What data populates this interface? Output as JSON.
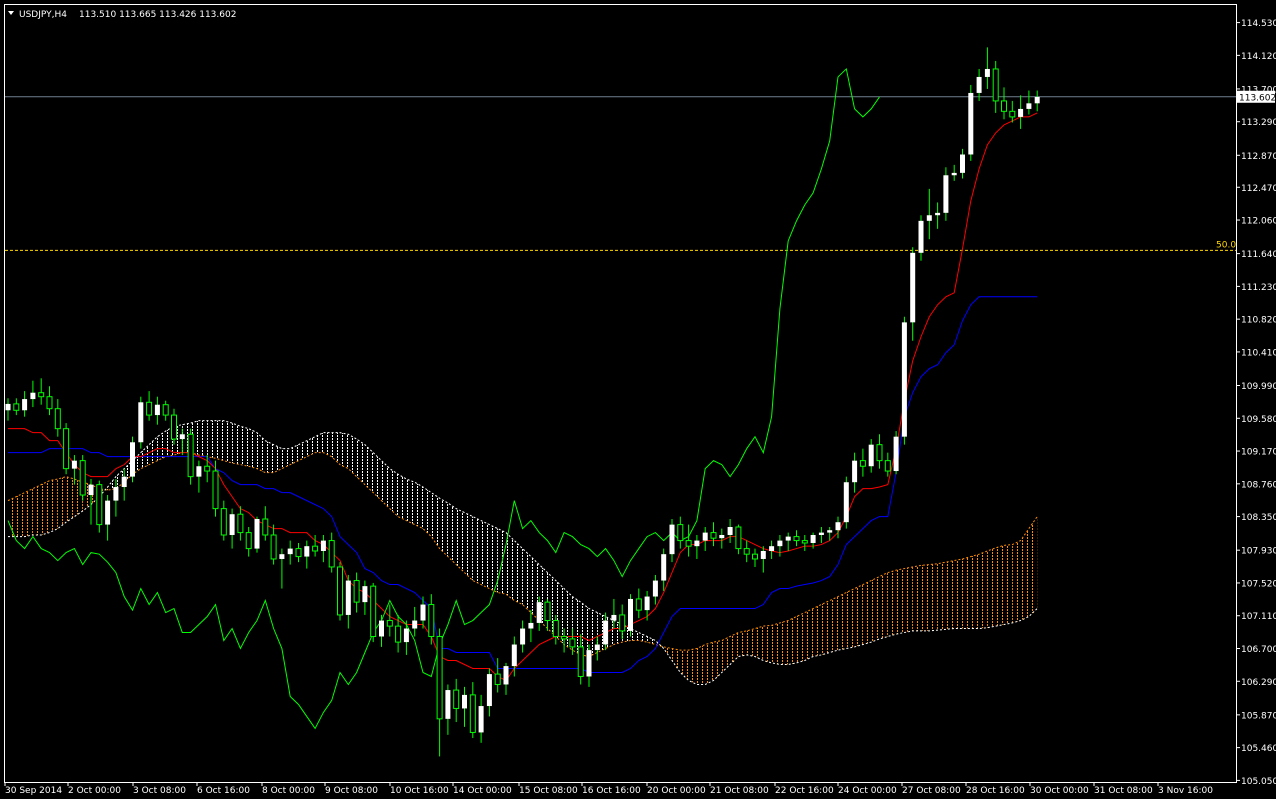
{
  "window": {
    "symbol_title": "USDJPY,H4",
    "ohlc": "113.510 113.665 113.426 113.602",
    "menu_icon": "triangle-down-icon"
  },
  "colors": {
    "background": "#000000",
    "frame": "#ffffff",
    "bull_candle": "#ffffff",
    "wick": "#00ff00",
    "tenkan": "#ff0000",
    "kijun": "#0000ff",
    "chikou": "#00ff00",
    "cloud_bear": "#ffffff",
    "cloud_bull": "#ff8c00",
    "bid_line": "#708090",
    "fibo_line": "#ffd700"
  },
  "chart_data": {
    "type": "candlestick",
    "timeframe": "H4",
    "ylim": [
      105.03,
      114.75
    ],
    "y_ticks": [
      "114.530",
      "114.120",
      "113.700",
      "113.290",
      "112.870",
      "112.470",
      "112.060",
      "111.640",
      "111.230",
      "110.820",
      "110.410",
      "109.990",
      "109.580",
      "109.170",
      "108.760",
      "108.350",
      "107.930",
      "107.520",
      "107.110",
      "106.700",
      "106.290",
      "105.870",
      "105.460",
      "105.050"
    ],
    "x_ticks": [
      "30 Sep 2014",
      "2 Oct 00:00",
      "3 Oct 08:00",
      "6 Oct 16:00",
      "8 Oct 00:00",
      "9 Oct 08:00",
      "10 Oct 16:00",
      "14 Oct 00:00",
      "15 Oct 08:00",
      "16 Oct 16:00",
      "20 Oct 00:00",
      "21 Oct 08:00",
      "22 Oct 16:00",
      "24 Oct 00:00",
      "27 Oct 08:00",
      "28 Oct 16:00",
      "30 Oct 00:00",
      "31 Oct 08:00",
      "3 Nov 16:00"
    ],
    "current_price": "113.602",
    "fibo_label": "50.0",
    "fibo_level": 111.68,
    "candles": [
      [
        109.68,
        109.83,
        109.55,
        109.76
      ],
      [
        109.76,
        109.83,
        109.62,
        109.68
      ],
      [
        109.68,
        109.92,
        109.6,
        109.82
      ],
      [
        109.82,
        110.05,
        109.72,
        109.9
      ],
      [
        109.9,
        110.08,
        109.75,
        109.85
      ],
      [
        109.85,
        109.98,
        109.62,
        109.7
      ],
      [
        109.7,
        109.82,
        109.35,
        109.45
      ],
      [
        109.45,
        109.52,
        108.88,
        108.95
      ],
      [
        108.95,
        109.12,
        108.75,
        109.05
      ],
      [
        109.05,
        109.12,
        108.55,
        108.62
      ],
      [
        108.62,
        108.82,
        108.25,
        108.75
      ],
      [
        108.75,
        108.8,
        108.15,
        108.25
      ],
      [
        108.25,
        108.62,
        108.05,
        108.55
      ],
      [
        108.55,
        108.82,
        108.35,
        108.72
      ],
      [
        108.72,
        108.95,
        108.55,
        108.85
      ],
      [
        108.85,
        109.35,
        108.78,
        109.28
      ],
      [
        109.28,
        109.85,
        109.2,
        109.78
      ],
      [
        109.78,
        109.92,
        109.55,
        109.62
      ],
      [
        109.62,
        109.85,
        109.5,
        109.75
      ],
      [
        109.75,
        109.8,
        109.55,
        109.62
      ],
      [
        109.62,
        109.7,
        109.25,
        109.32
      ],
      [
        109.32,
        109.45,
        109.12,
        109.38
      ],
      [
        109.38,
        109.45,
        108.75,
        108.85
      ],
      [
        108.85,
        109.05,
        108.65,
        108.98
      ],
      [
        108.98,
        109.12,
        108.78,
        108.92
      ],
      [
        108.92,
        109.05,
        108.35,
        108.45
      ],
      [
        108.45,
        108.55,
        108.05,
        108.12
      ],
      [
        108.12,
        108.45,
        107.95,
        108.38
      ],
      [
        108.38,
        108.48,
        108.05,
        108.15
      ],
      [
        108.15,
        108.22,
        107.85,
        107.95
      ],
      [
        107.95,
        108.35,
        107.9,
        108.32
      ],
      [
        108.32,
        108.48,
        108.05,
        108.12
      ],
      [
        108.12,
        108.25,
        107.75,
        107.82
      ],
      [
        107.82,
        107.95,
        107.45,
        107.88
      ],
      [
        107.88,
        108.05,
        107.75,
        107.95
      ],
      [
        107.95,
        108.02,
        107.78,
        107.85
      ],
      [
        107.85,
        108.05,
        107.7,
        107.98
      ],
      [
        107.98,
        108.12,
        107.85,
        107.92
      ],
      [
        107.92,
        108.12,
        107.78,
        108.05
      ],
      [
        108.05,
        108.15,
        107.65,
        107.72
      ],
      [
        107.72,
        107.78,
        107.05,
        107.12
      ],
      [
        107.12,
        107.62,
        106.95,
        107.55
      ],
      [
        107.55,
        107.65,
        107.15,
        107.28
      ],
      [
        107.28,
        107.55,
        107.12,
        107.48
      ],
      [
        107.48,
        107.52,
        106.78,
        106.85
      ],
      [
        106.85,
        107.12,
        106.72,
        107.05
      ],
      [
        107.05,
        107.25,
        106.85,
        106.98
      ],
      [
        106.98,
        107.12,
        106.65,
        106.78
      ],
      [
        106.78,
        107.05,
        106.62,
        106.95
      ],
      [
        106.95,
        107.22,
        106.85,
        107.05
      ],
      [
        107.05,
        107.35,
        106.95,
        107.25
      ],
      [
        107.25,
        107.38,
        106.75,
        106.85
      ],
      [
        106.85,
        106.95,
        105.35,
        105.82
      ],
      [
        105.82,
        106.25,
        105.62,
        106.18
      ],
      [
        106.18,
        106.32,
        105.78,
        105.95
      ],
      [
        105.95,
        106.22,
        105.72,
        106.12
      ],
      [
        106.12,
        106.28,
        105.58,
        105.65
      ],
      [
        105.65,
        106.12,
        105.52,
        105.98
      ],
      [
        105.98,
        106.45,
        105.85,
        106.38
      ],
      [
        106.38,
        106.58,
        106.15,
        106.25
      ],
      [
        106.25,
        106.52,
        106.12,
        106.48
      ],
      [
        106.48,
        106.85,
        106.35,
        106.75
      ],
      [
        106.75,
        107.05,
        106.65,
        106.95
      ],
      [
        106.95,
        107.18,
        106.78,
        107.02
      ],
      [
        107.02,
        107.35,
        106.92,
        107.28
      ],
      [
        107.28,
        107.32,
        106.92,
        107.05
      ],
      [
        107.05,
        107.12,
        106.75,
        106.85
      ],
      [
        106.85,
        106.95,
        106.65,
        106.82
      ],
      [
        106.82,
        106.95,
        106.62,
        106.72
      ],
      [
        106.72,
        106.88,
        106.25,
        106.35
      ],
      [
        106.35,
        106.75,
        106.22,
        106.68
      ],
      [
        106.68,
        106.85,
        106.55,
        106.75
      ],
      [
        106.75,
        107.15,
        106.68,
        107.05
      ],
      [
        107.05,
        107.32,
        106.95,
        107.12
      ],
      [
        107.12,
        107.25,
        106.82,
        106.92
      ],
      [
        106.92,
        107.38,
        106.85,
        107.32
      ],
      [
        107.32,
        107.45,
        107.08,
        107.18
      ],
      [
        107.18,
        107.42,
        107.05,
        107.35
      ],
      [
        107.35,
        107.62,
        107.25,
        107.55
      ],
      [
        107.55,
        107.95,
        107.42,
        107.88
      ],
      [
        107.88,
        108.32,
        107.78,
        108.25
      ],
      [
        108.25,
        108.35,
        107.95,
        108.05
      ],
      [
        108.05,
        108.25,
        107.85,
        107.98
      ],
      [
        107.98,
        108.12,
        107.82,
        108.05
      ],
      [
        108.05,
        108.22,
        107.92,
        108.15
      ],
      [
        108.15,
        108.28,
        107.98,
        108.08
      ],
      [
        108.08,
        108.2,
        107.95,
        108.12
      ],
      [
        108.12,
        108.32,
        108.02,
        108.22
      ],
      [
        108.22,
        108.25,
        107.88,
        107.95
      ],
      [
        107.95,
        108.05,
        107.78,
        107.88
      ],
      [
        107.88,
        107.95,
        107.72,
        107.82
      ],
      [
        107.82,
        107.98,
        107.65,
        107.92
      ],
      [
        107.92,
        108.05,
        107.82,
        107.98
      ],
      [
        107.98,
        108.12,
        107.85,
        108.05
      ],
      [
        108.05,
        108.15,
        107.92,
        108.1
      ],
      [
        108.1,
        108.18,
        107.98,
        108.05
      ],
      [
        108.05,
        108.12,
        107.92,
        108.02
      ],
      [
        108.02,
        108.15,
        107.95,
        108.12
      ],
      [
        108.12,
        108.22,
        108.02,
        108.15
      ],
      [
        108.15,
        108.22,
        108.05,
        108.18
      ],
      [
        108.18,
        108.35,
        108.08,
        108.28
      ],
      [
        108.28,
        108.85,
        108.2,
        108.78
      ],
      [
        108.78,
        109.15,
        108.65,
        109.05
      ],
      [
        109.05,
        109.2,
        108.85,
        108.98
      ],
      [
        108.98,
        109.32,
        108.9,
        109.25
      ],
      [
        109.25,
        109.38,
        108.95,
        109.05
      ],
      [
        109.05,
        109.15,
        108.85,
        108.92
      ],
      [
        108.92,
        109.42,
        108.88,
        109.35
      ],
      [
        109.35,
        110.85,
        109.25,
        110.78
      ],
      [
        110.78,
        111.72,
        110.55,
        111.65
      ],
      [
        111.65,
        112.12,
        111.55,
        112.05
      ],
      [
        112.05,
        112.45,
        111.82,
        112.12
      ],
      [
        112.12,
        112.28,
        111.95,
        112.15
      ],
      [
        112.15,
        112.72,
        112.05,
        112.62
      ],
      [
        112.62,
        112.75,
        112.55,
        112.65
      ],
      [
        112.65,
        112.95,
        112.58,
        112.88
      ],
      [
        112.88,
        113.75,
        112.8,
        113.65
      ],
      [
        113.65,
        113.95,
        113.55,
        113.85
      ],
      [
        113.85,
        114.22,
        113.7,
        113.95
      ],
      [
        113.95,
        114.05,
        113.4,
        113.55
      ],
      [
        113.55,
        113.72,
        113.32,
        113.42
      ],
      [
        113.42,
        113.55,
        113.28,
        113.35
      ],
      [
        113.35,
        113.62,
        113.2,
        113.45
      ],
      [
        113.45,
        113.68,
        113.38,
        113.52
      ],
      [
        113.52,
        113.68,
        113.42,
        113.6
      ]
    ],
    "tenkan": [
      109.45,
      109.45,
      109.45,
      109.4,
      109.4,
      109.3,
      109.3,
      109.15,
      109.0,
      108.9,
      108.85,
      108.85,
      108.85,
      108.95,
      109.0,
      109.1,
      109.1,
      109.15,
      109.2,
      109.2,
      109.15,
      109.15,
      109.15,
      109.1,
      109.05,
      108.95,
      108.75,
      108.6,
      108.45,
      108.4,
      108.3,
      108.25,
      108.2,
      108.2,
      108.15,
      108.15,
      108.15,
      108.05,
      108.0,
      107.9,
      107.8,
      107.55,
      107.45,
      107.4,
      107.3,
      107.2,
      107.1,
      107.05,
      107.0,
      107.0,
      107.0,
      106.85,
      106.6,
      106.55,
      106.55,
      106.5,
      106.45,
      106.45,
      106.45,
      106.35,
      106.3,
      106.45,
      106.55,
      106.65,
      106.75,
      106.8,
      106.85,
      106.85,
      106.85,
      106.85,
      106.8,
      106.85,
      106.9,
      106.95,
      106.95,
      107.0,
      107.05,
      107.1,
      107.2,
      107.4,
      107.65,
      107.9,
      108.0,
      108.0,
      108.05,
      108.05,
      108.05,
      108.1,
      108.1,
      108.05,
      108.0,
      107.95,
      107.92,
      107.9,
      107.92,
      107.95,
      107.98,
      107.98,
      108.0,
      108.05,
      108.15,
      108.35,
      108.6,
      108.7,
      108.7,
      108.72,
      108.75,
      109.2,
      109.8,
      110.3,
      110.6,
      110.85,
      111.0,
      111.1,
      111.15,
      111.7,
      112.3,
      112.7,
      113.0,
      113.15,
      113.25,
      113.3,
      113.35,
      113.35,
      113.4
    ],
    "kijun": [
      109.15,
      109.15,
      109.15,
      109.15,
      109.15,
      109.2,
      109.2,
      109.2,
      109.2,
      109.2,
      109.15,
      109.15,
      109.1,
      109.1,
      109.1,
      109.1,
      109.1,
      109.1,
      109.1,
      109.1,
      109.1,
      109.1,
      109.1,
      109.1,
      109.1,
      108.95,
      108.9,
      108.8,
      108.75,
      108.75,
      108.75,
      108.7,
      108.7,
      108.65,
      108.65,
      108.6,
      108.55,
      108.5,
      108.45,
      108.35,
      108.1,
      108.0,
      107.9,
      107.7,
      107.65,
      107.55,
      107.5,
      107.5,
      107.45,
      107.4,
      107.3,
      107.2,
      106.7,
      106.7,
      106.65,
      106.65,
      106.65,
      106.65,
      106.65,
      106.45,
      106.45,
      106.45,
      106.45,
      106.45,
      106.45,
      106.45,
      106.45,
      106.45,
      106.45,
      106.45,
      106.4,
      106.4,
      106.4,
      106.4,
      106.4,
      106.45,
      106.55,
      106.6,
      106.7,
      106.9,
      107.1,
      107.2,
      107.2,
      107.2,
      107.2,
      107.2,
      107.2,
      107.2,
      107.2,
      107.2,
      107.2,
      107.25,
      107.4,
      107.45,
      107.45,
      107.48,
      107.5,
      107.52,
      107.55,
      107.6,
      107.75,
      108.0,
      108.1,
      108.2,
      108.3,
      108.35,
      108.35,
      108.9,
      109.6,
      109.9,
      110.1,
      110.2,
      110.25,
      110.4,
      110.5,
      110.8,
      111.0,
      111.1,
      111.1,
      111.1,
      111.1,
      111.1,
      111.1,
      111.1,
      111.1
    ],
    "span_a": [
      108.55,
      108.6,
      108.65,
      108.7,
      108.75,
      108.8,
      108.82,
      108.85,
      108.82,
      108.78,
      108.75,
      108.7,
      108.68,
      108.7,
      108.78,
      108.88,
      108.95,
      109.0,
      109.05,
      109.1,
      109.12,
      109.15,
      109.15,
      109.12,
      109.1,
      109.08,
      109.05,
      109.02,
      109.0,
      108.98,
      108.95,
      108.9,
      108.9,
      108.95,
      109.0,
      109.05,
      109.1,
      109.15,
      109.15,
      109.1,
      109.0,
      108.95,
      108.85,
      108.75,
      108.65,
      108.55,
      108.45,
      108.35,
      108.3,
      108.25,
      108.2,
      108.1,
      107.95,
      107.85,
      107.75,
      107.65,
      107.55,
      107.5,
      107.45,
      107.4,
      107.38,
      107.3,
      107.25,
      107.15,
      107.05,
      106.95,
      106.85,
      106.75,
      106.68,
      106.62,
      106.6,
      106.65,
      106.7,
      106.75,
      106.78,
      106.8,
      106.8,
      106.78,
      106.75,
      106.72,
      106.7,
      106.68,
      106.68,
      106.7,
      106.75,
      106.78,
      106.8,
      106.85,
      106.9,
      106.92,
      106.95,
      106.98,
      106.99,
      107.02,
      107.05,
      107.1,
      107.15,
      107.2,
      107.25,
      107.3,
      107.35,
      107.4,
      107.45,
      107.5,
      107.55,
      107.6,
      107.65,
      107.68,
      107.7,
      107.72,
      107.74,
      107.75,
      107.76,
      107.78,
      107.8,
      107.82,
      107.85,
      107.88,
      107.92,
      107.96,
      107.99,
      108.0,
      108.05,
      108.2,
      108.35
    ],
    "span_b": [
      108.1,
      108.1,
      108.1,
      108.12,
      108.12,
      108.15,
      108.2,
      108.28,
      108.35,
      108.42,
      108.5,
      108.6,
      108.72,
      108.85,
      108.95,
      109.05,
      109.15,
      109.25,
      109.35,
      109.42,
      109.48,
      109.5,
      109.52,
      109.55,
      109.55,
      109.55,
      109.55,
      109.52,
      109.48,
      109.45,
      109.4,
      109.3,
      109.25,
      109.2,
      109.2,
      109.25,
      109.3,
      109.35,
      109.4,
      109.4,
      109.4,
      109.38,
      109.32,
      109.25,
      109.15,
      109.05,
      108.95,
      108.88,
      108.82,
      108.78,
      108.72,
      108.65,
      108.58,
      108.52,
      108.45,
      108.4,
      108.35,
      108.3,
      108.25,
      108.2,
      108.15,
      108.05,
      107.95,
      107.85,
      107.75,
      107.65,
      107.55,
      107.45,
      107.35,
      107.28,
      107.2,
      107.15,
      107.1,
      107.05,
      107.0,
      106.95,
      106.9,
      106.85,
      106.8,
      106.7,
      106.55,
      106.4,
      106.3,
      106.25,
      106.25,
      106.3,
      106.4,
      106.5,
      106.6,
      106.62,
      106.6,
      106.55,
      106.52,
      106.5,
      106.5,
      106.52,
      106.55,
      106.6,
      106.62,
      106.65,
      106.68,
      106.7,
      106.72,
      106.75,
      106.78,
      106.82,
      106.85,
      106.88,
      106.9,
      106.92,
      106.92,
      106.92,
      106.93,
      106.94,
      106.95,
      106.95,
      106.95,
      106.95,
      106.96,
      106.98,
      107.0,
      107.02,
      107.05,
      107.1,
      107.2
    ],
    "chikou": [
      108.3,
      108.05,
      107.95,
      108.1,
      107.95,
      107.9,
      107.8,
      107.9,
      107.95,
      107.75,
      107.9,
      107.88,
      107.78,
      107.65,
      107.35,
      107.18,
      107.45,
      107.25,
      107.4,
      107.15,
      107.2,
      106.9,
      106.9,
      107.0,
      107.1,
      107.25,
      106.8,
      106.95,
      106.7,
      106.9,
      107.05,
      107.3,
      106.95,
      106.7,
      106.1,
      106.0,
      105.85,
      105.7,
      105.9,
      106.05,
      106.4,
      106.25,
      106.4,
      106.65,
      106.9,
      107.05,
      107.3,
      107.1,
      107.0,
      106.8,
      106.4,
      106.35,
      106.75,
      107.0,
      107.3,
      107.0,
      107.05,
      107.15,
      107.25,
      107.55,
      108.0,
      108.55,
      108.2,
      108.3,
      108.15,
      108.05,
      107.9,
      108.15,
      108.1,
      108.0,
      107.95,
      107.85,
      107.95,
      107.8,
      107.6,
      107.8,
      107.95,
      108.1,
      108.15,
      108.05,
      108.15,
      108.05,
      108.1,
      108.3,
      108.95,
      109.05,
      109.0,
      108.85,
      109.0,
      109.2,
      109.35,
      109.15,
      109.6,
      110.95,
      111.8,
      112.05,
      112.25,
      112.4,
      112.7,
      113.05,
      113.85,
      113.95,
      113.45,
      113.35,
      113.45,
      113.6
    ]
  }
}
